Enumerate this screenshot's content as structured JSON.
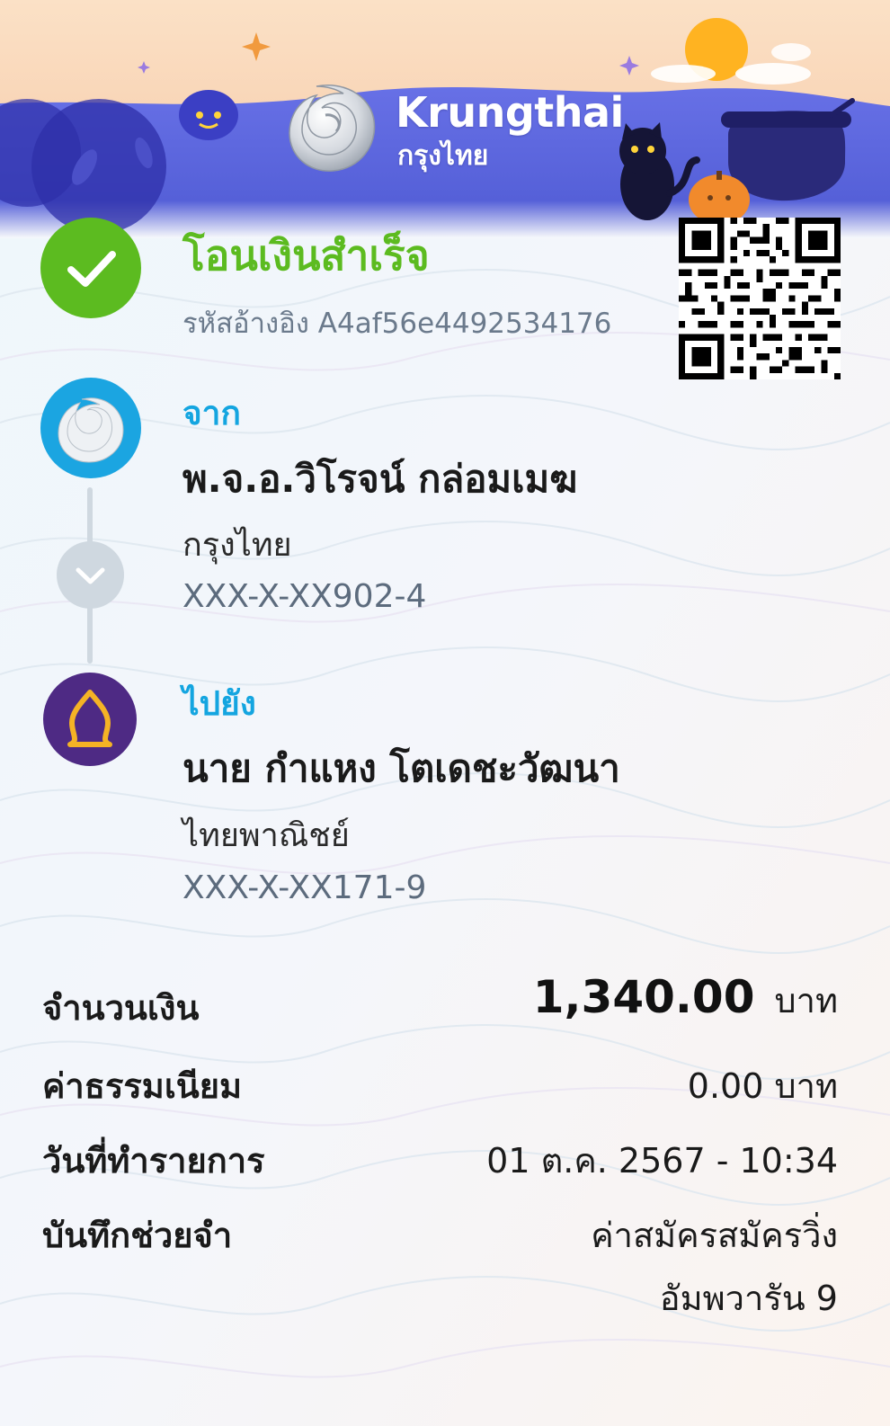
{
  "brand": {
    "name_en": "Krungthai",
    "name_th": "กรุงไทย",
    "primary_color": "#1ba5e1",
    "banner_color": "#5a63dc"
  },
  "status": {
    "title": "โอนเงินสำเร็จ",
    "reference": "รหัสอ้างอิง A4af56e4492534176",
    "icon": "check-icon",
    "color": "#5cbb20"
  },
  "from": {
    "label": "จาก",
    "name": "พ.จ.อ.วิโรจน์ กล่อมเมฆ",
    "bank": "กรุงไทย",
    "account": "XXX-X-XX902-4",
    "icon": "krungthai-bank-logo"
  },
  "to": {
    "label": "ไปยัง",
    "name": "นาย กำแหง โตเดชะวัฒนา",
    "bank": "ไทยพาณิชย์",
    "account": "XXX-X-XX171-9",
    "icon": "scb-bank-logo"
  },
  "details": {
    "amount_label": "จำนวนเงิน",
    "amount_value": "1,340.00",
    "amount_unit": "บาท",
    "fee_label": "ค่าธรรมเนียม",
    "fee_value": "0.00 บาท",
    "date_label": "วันที่ทำรายการ",
    "date_value": "01 ต.ค. 2567 - 10:34",
    "memo_label": "บันทึกช่วยจำ",
    "memo_line1": "ค่าสมัครสมัครวิ่ง",
    "memo_line2": "อัมพวารัน 9"
  }
}
